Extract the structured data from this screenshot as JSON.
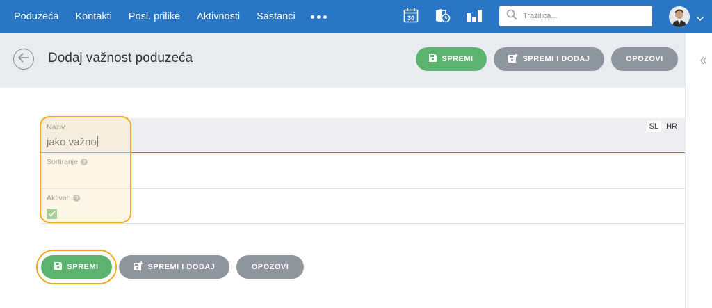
{
  "nav": {
    "items": [
      "Poduzeća",
      "Kontakti",
      "Posl. prilike",
      "Aktivnosti",
      "Sastanci"
    ],
    "more_icon": "more-dots-icon"
  },
  "topbar": {
    "calendar_day": "30",
    "search_placeholder": "Tražilica..."
  },
  "header": {
    "title": "Dodaj važnost poduzeća",
    "save_label": "SPREMI",
    "save_add_label": "SPREMI I DODAJ",
    "cancel_label": "OPOZOVI"
  },
  "form": {
    "name_label": "Naziv",
    "name_value": "jako važno",
    "lang_sl": "SL",
    "lang_hr": "HR",
    "sort_label": "Sortiranje",
    "active_label": "Aktivan",
    "active_checked": true
  },
  "footer": {
    "save_label": "SPREMI",
    "save_add_label": "SPREMI I DODAJ",
    "cancel_label": "OPOZOVI"
  },
  "colors": {
    "topbar": "#2a76c6",
    "primary_button": "#5cb370",
    "secondary_button": "#8f959d",
    "highlight": "#f5a623"
  }
}
